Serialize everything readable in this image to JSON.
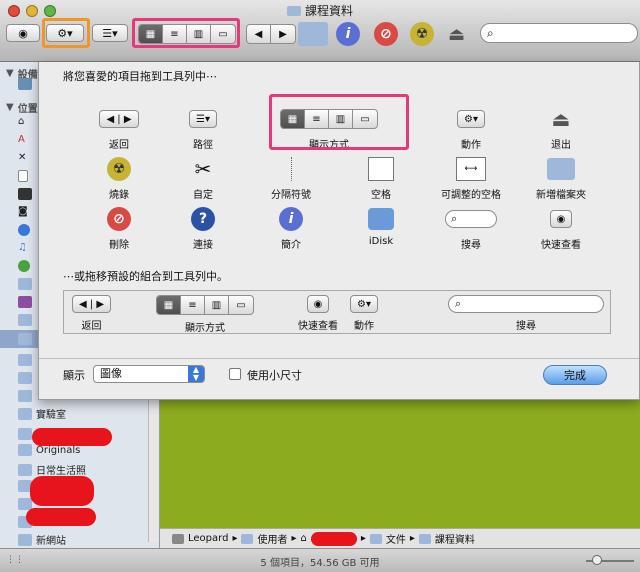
{
  "window": {
    "title": "課程資料"
  },
  "toolbar": {
    "search_placeholder": ""
  },
  "sidebar": {
    "section_devices": "設備",
    "section_places": "位置",
    "items": [
      {
        "label": "實驗室"
      },
      {
        "label": "Originals"
      },
      {
        "label": "日常生活照"
      },
      {
        "label": "新網站"
      }
    ]
  },
  "sheet": {
    "drag_title": "將您喜愛的項目拖到工具列中⋯",
    "default_title": "⋯或拖移預設的組合到工具列中。",
    "tools": [
      {
        "label": "返回"
      },
      {
        "label": "路徑"
      },
      {
        "label": "顯示方式"
      },
      {
        "label": "動作"
      },
      {
        "label": "退出"
      },
      {
        "label": "燒錄"
      },
      {
        "label": "自定"
      },
      {
        "label": "分隔符號"
      },
      {
        "label": "空格"
      },
      {
        "label": "可調整的空格"
      },
      {
        "label": "新増檔案夾"
      },
      {
        "label": "刪除"
      },
      {
        "label": "連接"
      },
      {
        "label": "簡介"
      },
      {
        "label": "iDisk"
      },
      {
        "label": "搜尋"
      },
      {
        "label": "快速查看"
      }
    ],
    "default_set": {
      "back": "返回",
      "view": "顯示方式",
      "quicklook": "快速查看",
      "action": "動作",
      "search": "搜尋"
    },
    "show_label": "顯示",
    "show_value": "圖像",
    "small_size_label": "使用小尺寸",
    "done": "完成"
  },
  "pathbar": {
    "items": [
      "Leopard",
      "使用者",
      "文件",
      "課程資料"
    ]
  },
  "status": {
    "text": "5 個項目，54.56 GB 可用"
  },
  "colors": {
    "highlight_pink": "#e6397d",
    "highlight_orange": "#f0952a",
    "desktop_green": "#8cac1f",
    "redact": "#e8141b"
  }
}
